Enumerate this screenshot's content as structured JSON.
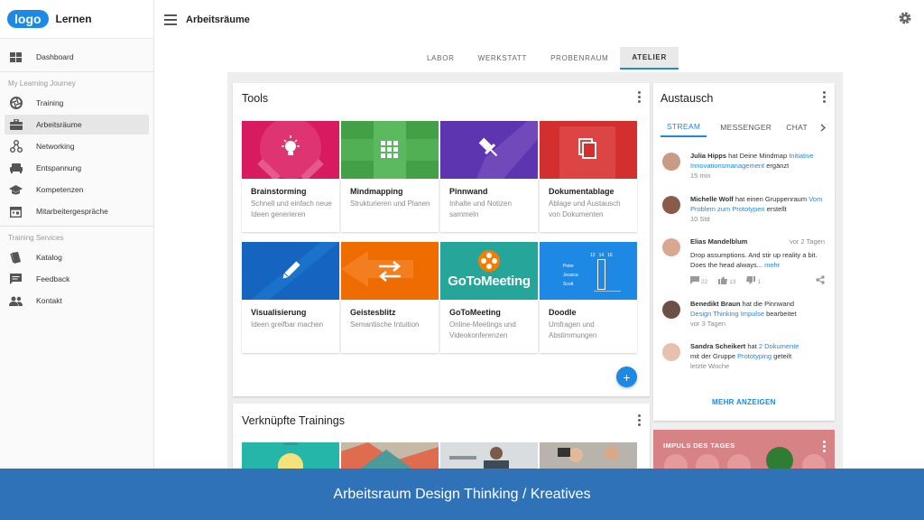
{
  "brand": {
    "logo": "logo",
    "name": "Lernen"
  },
  "topbar": {
    "title": "Arbeitsräume"
  },
  "sidebar": {
    "items_top": [
      {
        "label": "Dashboard",
        "icon": "dashboard-icon"
      }
    ],
    "section1": "My Learning Journey",
    "items1": [
      {
        "label": "Training",
        "icon": "aperture-icon"
      },
      {
        "label": "Arbeitsräume",
        "icon": "briefcase-icon"
      },
      {
        "label": "Networking",
        "icon": "network-icon"
      },
      {
        "label": "Entspannung",
        "icon": "sofa-icon"
      },
      {
        "label": "Kompetenzen",
        "icon": "graduation-cap-icon"
      },
      {
        "label": "Mitarbeitergespräche",
        "icon": "calendar-icon"
      }
    ],
    "section2": "Training Services",
    "items2": [
      {
        "label": "Katalog",
        "icon": "book-icon"
      },
      {
        "label": "Feedback",
        "icon": "comment-icon"
      },
      {
        "label": "Kontakt",
        "icon": "people-icon"
      }
    ]
  },
  "tabs": [
    "LABOR",
    "WERKSTATT",
    "PROBENRAUM",
    "ATELIER"
  ],
  "tools": {
    "title": "Tools",
    "items": [
      {
        "name": "Brainstorming",
        "desc": "Schnell und einfach neue Ideen generieren",
        "color": "#d81b60"
      },
      {
        "name": "Mindmapping",
        "desc": "Strukturieren und Planen",
        "color": "#43a047"
      },
      {
        "name": "Pinnwand",
        "desc": "Inhalte und Notizen sammeln",
        "color": "#5e35b1"
      },
      {
        "name": "Dokumentablage",
        "desc": "Ablage und Austausch von Dokumenten",
        "color": "#d32f2f"
      },
      {
        "name": "Visualisierung",
        "desc": "Ideen greifbar machen",
        "color": "#1565c0"
      },
      {
        "name": "Geistesblitz",
        "desc": "Semantische Intuition",
        "color": "#ef6c00"
      },
      {
        "name": "GoToMeeting",
        "desc": "Online-Meetings und Videokonferenzen",
        "color": "#26a69a"
      },
      {
        "name": "Doodle",
        "desc": "Umfragen und Abstimmungen",
        "color": "#1e88e5"
      }
    ],
    "gotomeeting_logo": "GoToMeeting",
    "doodle_names": [
      "Peter",
      "Jessica",
      "Scott"
    ],
    "doodle_dates": [
      "12",
      "14",
      "16"
    ]
  },
  "trainings": {
    "title": "Verknüpfte Trainings"
  },
  "exchange": {
    "title": "Austausch",
    "tabs": [
      "STREAM",
      "MESSENGER",
      "CHAT"
    ],
    "feed": [
      {
        "name": "Julia Hipps",
        "pre": " hat Deine Mindmap ",
        "link": "Initiative Innovationsmanagement",
        "post": " ergänzt",
        "time": "15 min",
        "avatar": "#c99a84"
      },
      {
        "name": "Michelle Wolf",
        "pre": " hat einen Gruppenraum ",
        "link": "Vom Problem zum Prototypen",
        "post": " erstellt",
        "time": "10 Std",
        "avatar": "#8a5a4a"
      },
      {
        "name": "Elias Mandelblum",
        "date": "vor 2 Tagen",
        "text": "Drop assumptions. And stir up reality a bit. Does the head always...",
        "more": " mehr",
        "likes": "13",
        "comments": "22",
        "dislikes": "1",
        "avatar": "#d8a890"
      },
      {
        "name": "Benedikt Braun",
        "pre": " hat die  Pinnwand ",
        "link": "Design Thinking Impulse",
        "post": " bearbeitet",
        "time": "vor 3 Tagen",
        "avatar": "#6d5044"
      },
      {
        "name": "Sandra Scheikert",
        "pre": " hat ",
        "link": "2 Dokumente",
        "post": " mit der Gruppe ",
        "link2": "Prototyping",
        "post2": " geteilt",
        "time": "letzte Woche",
        "avatar": "#e6c2ae"
      }
    ],
    "more_label": "MEHR ANZEIGEN"
  },
  "impulse": {
    "title": "IMPULS DES TAGES"
  },
  "footer": {
    "text": "Arbeitsraum Design Thinking / Kreatives"
  }
}
